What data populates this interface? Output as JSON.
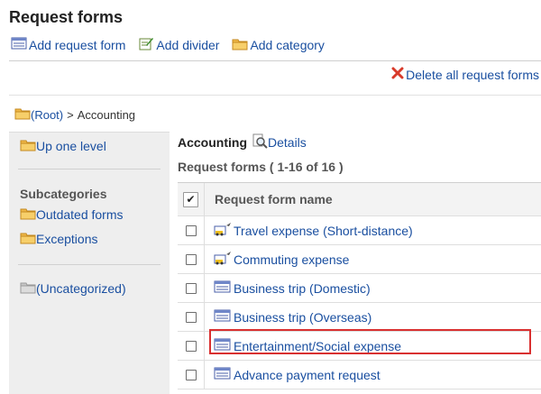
{
  "page": {
    "title": "Request forms"
  },
  "toolbar": {
    "add_request_form": "Add request form",
    "add_divider": "Add divider",
    "add_category": "Add category"
  },
  "delete_all": "Delete all request forms",
  "breadcrumb": {
    "root": "(Root)",
    "separator": ">",
    "current": "Accounting"
  },
  "sidebar": {
    "up_one_level": "Up one level",
    "subcategories_heading": "Subcategories",
    "subcategories": [
      "Outdated forms",
      "Exceptions"
    ],
    "uncategorized": "(Uncategorized)"
  },
  "main": {
    "category_name": "Accounting",
    "details_label": "Details",
    "count_label": "Request forms ( 1-16 of 16 )",
    "table": {
      "header_checkbox": "✔",
      "column_header": "Request form name",
      "rows": [
        {
          "name": "Travel expense (Short-distance)",
          "icon": "vehicle-form-icon"
        },
        {
          "name": "Commuting expense",
          "icon": "vehicle-form-icon"
        },
        {
          "name": "Business trip (Domestic)",
          "icon": "form-icon"
        },
        {
          "name": "Business trip (Overseas)",
          "icon": "form-icon"
        },
        {
          "name": "Entertainment/Social expense",
          "icon": "form-icon"
        },
        {
          "name": "Advance payment request",
          "icon": "form-icon"
        }
      ]
    }
  },
  "colors": {
    "link": "#1a4fa0",
    "highlight": "#d93030",
    "delete": "#d83a2a",
    "folder": "#f0b848"
  }
}
